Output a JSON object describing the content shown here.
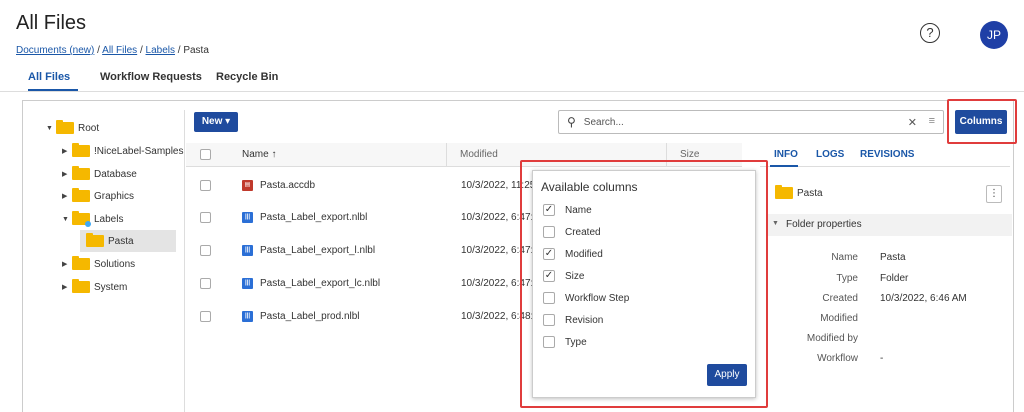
{
  "header": {
    "title": "All Files",
    "breadcrumb": [
      {
        "label": "Documents (new)",
        "link": true
      },
      {
        "label": "All Files",
        "link": true
      },
      {
        "label": "Labels",
        "link": true
      },
      {
        "label": "Pasta",
        "link": false
      }
    ],
    "help_symbol": "?",
    "avatar_initials": "JP"
  },
  "tabs": [
    {
      "label": "All Files",
      "active": true
    },
    {
      "label": "Workflow Requests",
      "active": false
    },
    {
      "label": "Recycle Bin",
      "active": false
    }
  ],
  "tree": [
    {
      "label": "Root",
      "expanded": true,
      "level": 0
    },
    {
      "label": "!NiceLabel-Samples",
      "expanded": false,
      "level": 1
    },
    {
      "label": "Database",
      "expanded": false,
      "level": 1
    },
    {
      "label": "Graphics",
      "expanded": false,
      "level": 1
    },
    {
      "label": "Labels",
      "expanded": true,
      "level": 1
    },
    {
      "label": "Pasta",
      "selected": true,
      "level": 2
    },
    {
      "label": "Solutions",
      "expanded": false,
      "level": 1
    },
    {
      "label": "System",
      "expanded": false,
      "level": 1
    }
  ],
  "toolbar": {
    "new_label": "New ▾",
    "search_placeholder": "Search...",
    "clear_symbol": "✕",
    "filter_symbol": "≡",
    "columns_label": "Columns"
  },
  "table": {
    "columns": [
      "Name ↑",
      "Modified",
      "Size"
    ],
    "rows": [
      {
        "name": "Pasta.accdb",
        "modified": "10/3/2022, 11:25",
        "icon": "database-file-icon",
        "icon_color": "#c0392b"
      },
      {
        "name": "Pasta_Label_export.nlbl",
        "modified": "10/3/2022, 6:47:2",
        "icon": "label-file-icon",
        "icon_color": "#2b6fd6"
      },
      {
        "name": "Pasta_Label_export_l.nlbl",
        "modified": "10/3/2022, 6:47:2",
        "icon": "label-file-icon",
        "icon_color": "#2b6fd6"
      },
      {
        "name": "Pasta_Label_export_lc.nlbl",
        "modified": "10/3/2022, 6:47:2",
        "icon": "label-file-icon",
        "icon_color": "#2b6fd6"
      },
      {
        "name": "Pasta_Label_prod.nlbl",
        "modified": "10/3/2022, 6:48:2",
        "icon": "label-file-icon",
        "icon_color": "#2b6fd6"
      }
    ]
  },
  "columns_popup": {
    "title": "Available columns",
    "options": [
      {
        "label": "Name",
        "checked": true
      },
      {
        "label": "Created",
        "checked": false
      },
      {
        "label": "Modified",
        "checked": true
      },
      {
        "label": "Size",
        "checked": true
      },
      {
        "label": "Workflow Step",
        "checked": false
      },
      {
        "label": "Revision",
        "checked": false
      },
      {
        "label": "Type",
        "checked": false
      }
    ],
    "apply_label": "Apply"
  },
  "panel": {
    "tabs": [
      "INFO",
      "LOGS",
      "REVISIONS"
    ],
    "title": "Pasta",
    "kebab_symbol": "⋮",
    "section_label": "Folder properties",
    "properties": [
      {
        "label": "Name",
        "value": "Pasta"
      },
      {
        "label": "Type",
        "value": "Folder"
      },
      {
        "label": "Created",
        "value": "10/3/2022, 6:46 AM"
      },
      {
        "label": "Modified",
        "value": ""
      },
      {
        "label": "Modified by",
        "value": ""
      },
      {
        "label": "Workflow",
        "value": "-"
      }
    ]
  },
  "colors": {
    "primary": "#1f4b9e",
    "link": "#1a57a8",
    "folder": "#f5b800",
    "highlight_box": "#e03c3c"
  }
}
